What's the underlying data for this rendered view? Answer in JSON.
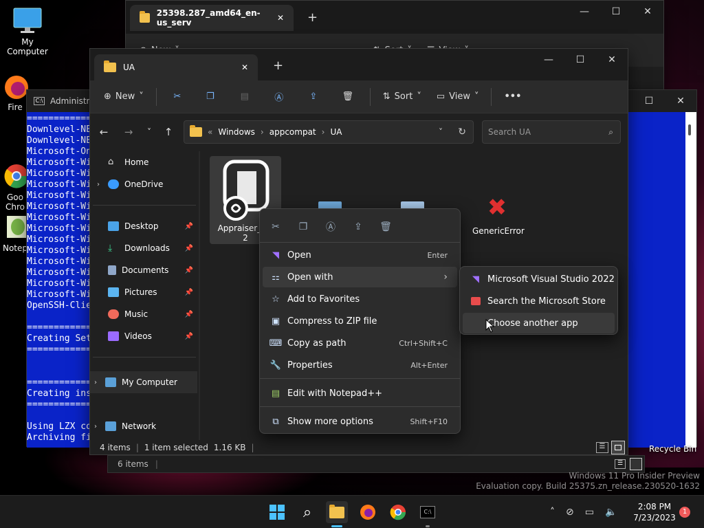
{
  "desktop": {
    "icons": [
      {
        "label": "My Computer"
      },
      {
        "label": "Fire"
      },
      {
        "label": "Goo\nChro"
      },
      {
        "label": "Notep"
      }
    ],
    "recycle_bin": "Recycle Bin",
    "watermark_line1": "Windows 11 Pro Insider Preview",
    "watermark_line2": "Evaluation copy. Build 25375.zn_release.230520-1632"
  },
  "back_window": {
    "tab_title": "25398.287_amd64_en-us_serv",
    "toolbar": {
      "new": "New",
      "sort": "Sort",
      "view": "View"
    },
    "status": "6 items"
  },
  "cmd_window": {
    "title": "Administrat",
    "lines": [
      "==============",
      "Downlevel-NE",
      "Downlevel-NE",
      "Microsoft-On",
      "Microsoft-Wi",
      "Microsoft-Wi",
      "Microsoft-Wi",
      "Microsoft-Wi",
      "Microsoft-Wi",
      "Microsoft-Wi",
      "Microsoft-Wi",
      "Microsoft-Wi",
      "Microsoft-Wi",
      "Microsoft-Wi",
      "Microsoft-Wi",
      "Microsoft-Wi",
      "Microsoft-Wi",
      "OpenSSH-Clie",
      "",
      "==============",
      "Creating Set",
      "==============",
      "",
      "",
      "==============",
      "Creating ins",
      "==============",
      "",
      "Using LZX co",
      "Archiving fi"
    ]
  },
  "explorer": {
    "tab_title": "UA",
    "toolbar": {
      "new": "New",
      "sort": "Sort",
      "view": "View"
    },
    "breadcrumb": [
      "Windows",
      "appcompat",
      "UA"
    ],
    "search_placeholder": "Search UA",
    "sidebar": [
      {
        "label": "Home",
        "color": "#e0e0e0"
      },
      {
        "label": "OneDrive",
        "color": "#3a9bff"
      },
      {
        "label": "Desktop",
        "color": "#4aa3e8"
      },
      {
        "label": "Downloads",
        "color": "#3ccf8e"
      },
      {
        "label": "Documents",
        "color": "#8fa7c9"
      },
      {
        "label": "Pictures",
        "color": "#5bb4f0"
      },
      {
        "label": "Music",
        "color": "#f06a5b"
      },
      {
        "label": "Videos",
        "color": "#9b6bff"
      },
      {
        "label": "My Computer",
        "color": "#5aa0d8"
      },
      {
        "label": "Network",
        "color": "#5aa0d8"
      }
    ],
    "files": [
      {
        "name": "Appraiser_ZN\n2"
      },
      {
        "name": "GenericError"
      }
    ],
    "status": {
      "count": "4 items",
      "selected": "1 item selected",
      "size": "1.16 KB"
    }
  },
  "context_menu": {
    "items": [
      {
        "label": "Open",
        "shortcut": "Enter"
      },
      {
        "label": "Open with",
        "shortcut": ""
      },
      {
        "label": "Add to Favorites",
        "shortcut": ""
      },
      {
        "label": "Compress to ZIP file",
        "shortcut": ""
      },
      {
        "label": "Copy as path",
        "shortcut": "Ctrl+Shift+C"
      },
      {
        "label": "Properties",
        "shortcut": "Alt+Enter"
      },
      {
        "label": "Edit with Notepad++",
        "shortcut": ""
      },
      {
        "label": "Show more options",
        "shortcut": "Shift+F10"
      }
    ]
  },
  "submenu": {
    "items": [
      {
        "label": "Microsoft Visual Studio 2022"
      },
      {
        "label": "Search the Microsoft Store"
      },
      {
        "label": "Choose another app"
      }
    ]
  },
  "taskbar": {
    "time": "2:08 PM",
    "date": "7/23/2023",
    "badge": "1"
  }
}
